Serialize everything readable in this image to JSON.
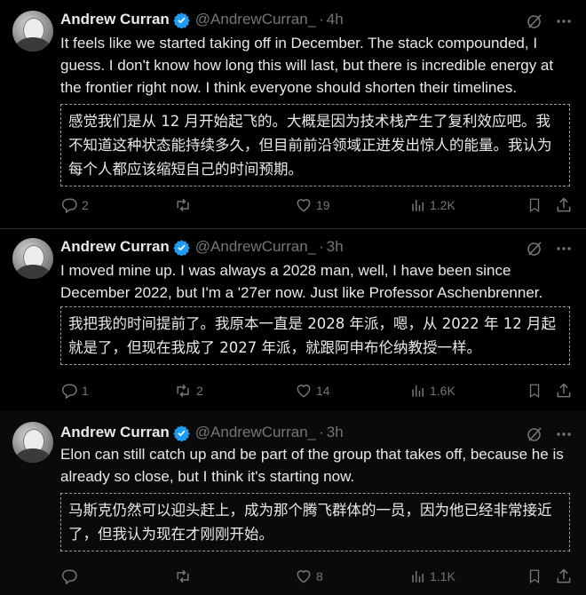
{
  "tweets": [
    {
      "author": "Andrew Curran",
      "handle": "@AndrewCurran_",
      "separator": "·",
      "time": "4h",
      "text": "It feels like we started taking off in December. The stack compounded, I guess. I don't know how long this will last, but there is incredible energy at the frontier right now. I think everyone should shorten their timelines.",
      "translation": "感觉我们是从 12 月开始起飞的。大概是因为技术栈产生了复利效应吧。我不知道这种状态能持续多久，但目前前沿领域正迸发出惊人的能量。我认为每个人都应该缩短自己的时间预期。",
      "replies": "2",
      "reposts": "",
      "likes": "19",
      "views": "1.2K"
    },
    {
      "author": "Andrew Curran",
      "handle": "@AndrewCurran_",
      "separator": "·",
      "time": "3h",
      "text": "I moved mine up. I was always a 2028 man, well, I have been since December 2022, but I'm a '27er now. Just like Professor Aschenbrenner.",
      "translation": "我把我的时间提前了。我原本一直是 2028 年派，嗯，从 2022 年 12 月起就是了，但现在我成了 2027 年派，就跟阿申布伦纳教授一样。",
      "replies": "1",
      "reposts": "2",
      "likes": "14",
      "views": "1.6K"
    },
    {
      "author": "Andrew Curran",
      "handle": "@AndrewCurran_",
      "separator": "·",
      "time": "3h",
      "text": "Elon can still catch up and be part of the group that takes off, because he is already so close, but I think it's starting now.",
      "translation": "马斯克仍然可以迎头赶上，成为那个腾飞群体的一员，因为他已经非常接近了，但我认为现在才刚刚开始。",
      "replies": "",
      "reposts": "",
      "likes": "8",
      "views": "1.1K"
    }
  ],
  "icons": {
    "verified": "verified-badge-icon",
    "grok": "grok-icon",
    "more": "more-icon",
    "reply": "reply-icon",
    "repost": "repost-icon",
    "like": "like-icon",
    "views": "views-icon",
    "bookmark": "bookmark-icon",
    "share": "share-icon"
  },
  "colors": {
    "background": "#000000",
    "text": "#e7e9ea",
    "muted": "#71767b",
    "verified": "#1d9bf0"
  }
}
